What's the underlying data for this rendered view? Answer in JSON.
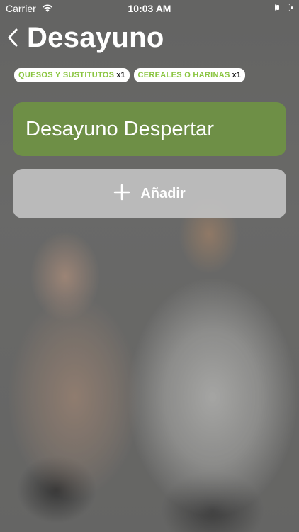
{
  "status_bar": {
    "carrier": "Carrier",
    "time": "10:03 AM",
    "battery_level": 0.15
  },
  "header": {
    "title": "Desayuno"
  },
  "chips": [
    {
      "label": "QUESOS Y SUSTITUTOS",
      "count": "x1"
    },
    {
      "label": "CEREALES O HARINAS",
      "count": "x1"
    }
  ],
  "meal": {
    "name": "Desayuno Despertar"
  },
  "add": {
    "label": "Añadir"
  },
  "colors": {
    "accent_green": "#6e8f46",
    "chip_text_green": "#8ac540"
  }
}
